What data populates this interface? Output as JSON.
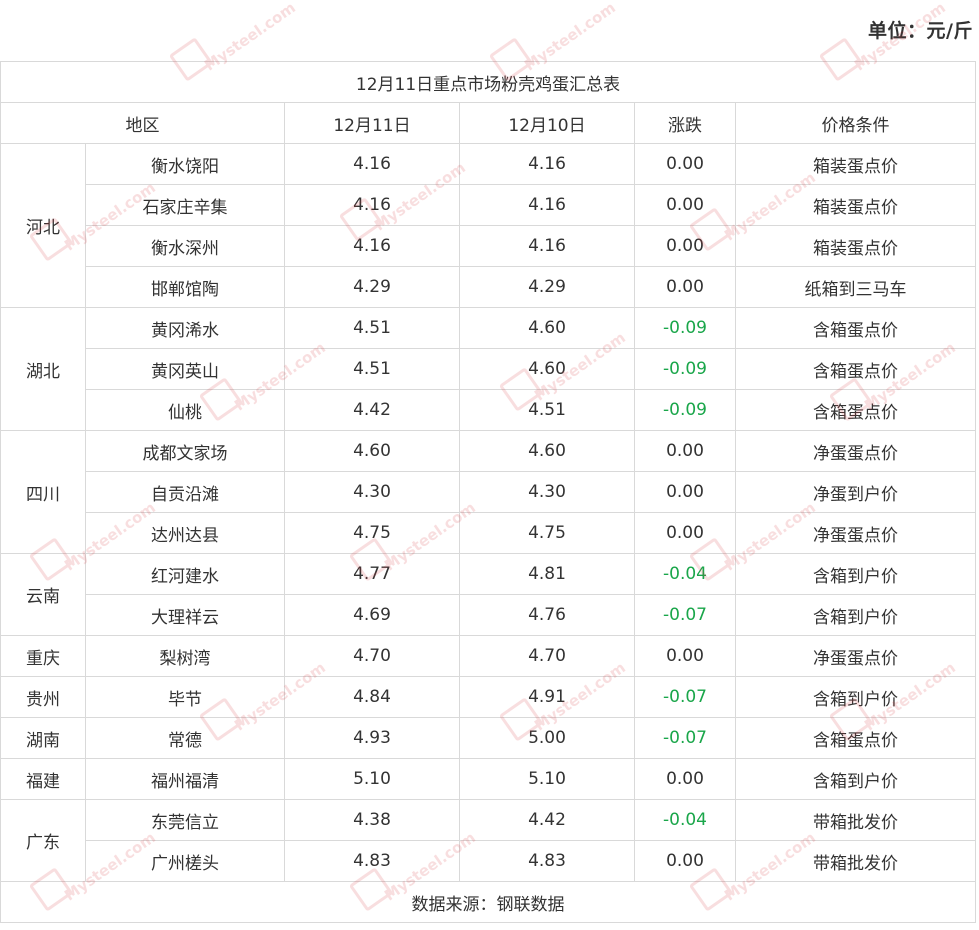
{
  "unit_label": "单位：元/斤",
  "table": {
    "title": "12月11日重点市场粉壳鸡蛋汇总表",
    "headers": {
      "region": "地区",
      "date1": "12月11日",
      "date2": "12月10日",
      "change": "涨跌",
      "condition": "价格条件"
    },
    "groups": [
      {
        "province": "河北",
        "rows": [
          {
            "market": "衡水饶阳",
            "price1": "4.16",
            "price2": "4.16",
            "change": "0.00",
            "condition": "箱装蛋点价"
          },
          {
            "market": "石家庄辛集",
            "price1": "4.16",
            "price2": "4.16",
            "change": "0.00",
            "condition": "箱装蛋点价"
          },
          {
            "market": "衡水深州",
            "price1": "4.16",
            "price2": "4.16",
            "change": "0.00",
            "condition": "箱装蛋点价"
          },
          {
            "market": "邯郸馆陶",
            "price1": "4.29",
            "price2": "4.29",
            "change": "0.00",
            "condition": "纸箱到三马车"
          }
        ]
      },
      {
        "province": "湖北",
        "rows": [
          {
            "market": "黄冈浠水",
            "price1": "4.51",
            "price2": "4.60",
            "change": "-0.09",
            "condition": "含箱蛋点价"
          },
          {
            "market": "黄冈英山",
            "price1": "4.51",
            "price2": "4.60",
            "change": "-0.09",
            "condition": "含箱蛋点价"
          },
          {
            "market": "仙桃",
            "price1": "4.42",
            "price2": "4.51",
            "change": "-0.09",
            "condition": "含箱蛋点价"
          }
        ]
      },
      {
        "province": "四川",
        "rows": [
          {
            "market": "成都文家场",
            "price1": "4.60",
            "price2": "4.60",
            "change": "0.00",
            "condition": "净蛋蛋点价"
          },
          {
            "market": "自贡沿滩",
            "price1": "4.30",
            "price2": "4.30",
            "change": "0.00",
            "condition": "净蛋到户价"
          },
          {
            "market": "达州达县",
            "price1": "4.75",
            "price2": "4.75",
            "change": "0.00",
            "condition": "净蛋蛋点价"
          }
        ]
      },
      {
        "province": "云南",
        "rows": [
          {
            "market": "红河建水",
            "price1": "4.77",
            "price2": "4.81",
            "change": "-0.04",
            "condition": "含箱到户价"
          },
          {
            "market": "大理祥云",
            "price1": "4.69",
            "price2": "4.76",
            "change": "-0.07",
            "condition": "含箱到户价"
          }
        ]
      },
      {
        "province": "重庆",
        "rows": [
          {
            "market": "梨树湾",
            "price1": "4.70",
            "price2": "4.70",
            "change": "0.00",
            "condition": "净蛋蛋点价"
          }
        ]
      },
      {
        "province": "贵州",
        "rows": [
          {
            "market": "毕节",
            "price1": "4.84",
            "price2": "4.91",
            "change": "-0.07",
            "condition": "含箱到户价"
          }
        ]
      },
      {
        "province": "湖南",
        "rows": [
          {
            "market": "常德",
            "price1": "4.93",
            "price2": "5.00",
            "change": "-0.07",
            "condition": "含箱蛋点价"
          }
        ]
      },
      {
        "province": "福建",
        "rows": [
          {
            "market": "福州福清",
            "price1": "5.10",
            "price2": "5.10",
            "change": "0.00",
            "condition": "含箱到户价"
          }
        ]
      },
      {
        "province": "广东",
        "rows": [
          {
            "market": "东莞信立",
            "price1": "4.38",
            "price2": "4.42",
            "change": "-0.04",
            "condition": "带箱批发价"
          },
          {
            "market": "广州槎头",
            "price1": "4.83",
            "price2": "4.83",
            "change": "0.00",
            "condition": "带箱批发价"
          }
        ]
      }
    ],
    "source": "数据来源：钢联数据"
  },
  "watermark": {
    "text": "Mysteel.com",
    "color": "#d9363e"
  },
  "colors": {
    "down": "#1aa64a",
    "text": "#333333",
    "border": "#d9d9d9"
  }
}
